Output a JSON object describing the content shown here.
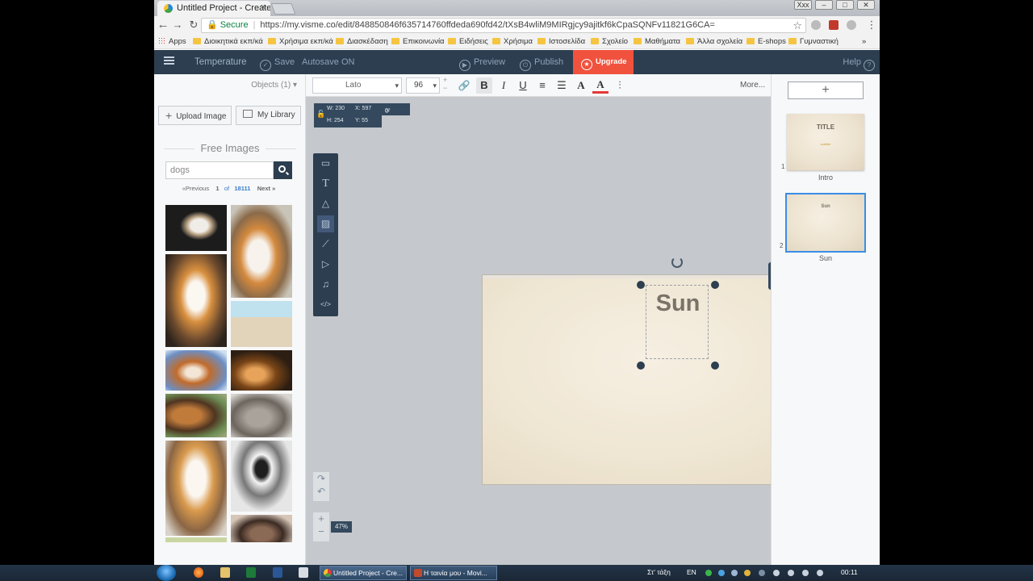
{
  "browser": {
    "tab_title": "Untitled Project - Create",
    "tab_close": "×",
    "window_buttons": [
      "Xxx",
      "–",
      "□",
      "✕"
    ],
    "url_secure_label": "Secure",
    "url": "https://my.visme.co/edit/848850846f635714760ffdeda690fd42/tXsB4wliM9MIRgjcy9ajitkf6kCpaSQNFv11821G6CA=",
    "bookmarks": [
      "Apps",
      "Διοικητικά εκπ/κά",
      "Χρήσιμα εκπ/κά",
      "Διασκέδαση",
      "Επικοινωνία",
      "Ειδήσεις",
      "Χρήσιμα",
      "Ιστοσελίδα",
      "Σχολείο",
      "Μαθήματα",
      "Άλλα σχολεία",
      "E-shops",
      "Γυμναστική"
    ],
    "bookmarks_more": "»"
  },
  "visme": {
    "project_name": "Temperature",
    "save_label": "Save",
    "autosave_label": "Autosave",
    "autosave_state": "ON",
    "preview_label": "Preview",
    "publish_label": "Publish",
    "upgrade_label": "Upgrade",
    "help_label": "Help"
  },
  "left_panel": {
    "objects_label": "Objects (1)",
    "upload_label": "Upload Image",
    "library_label": "My Library",
    "free_images_title": "Free Images",
    "search_value": "dogs",
    "pager": {
      "prev": "«Previous",
      "current": "1",
      "of": "of",
      "total": "18111",
      "next": "Next »"
    }
  },
  "format_bar": {
    "font": "Lato",
    "size": "96",
    "more_label": "More..."
  },
  "canvas": {
    "width_label": "W: 230",
    "x_label": "X: 597",
    "rotation_label": "0°",
    "height_label": "H: 254",
    "y_label": "Y: 55",
    "slide_text": "Sun",
    "zoom_label": "47%"
  },
  "slides_panel": {
    "slides": [
      {
        "number": "1",
        "label": "Intro",
        "title": "TITLE",
        "subtitle": "subtitle"
      },
      {
        "number": "2",
        "label": "Sun",
        "title": "Sun"
      }
    ]
  },
  "taskbar": {
    "tasks": [
      "Untitled Project - Cre...",
      "Η ταινία μου - Movi..."
    ],
    "lang_left": "Στ' τάξη",
    "lang": "EN",
    "clock": "00:11"
  },
  "colors": {
    "accent_dark": "#2c3e50",
    "upgrade": "#f0523d",
    "selection_blue": "#3a8ee6"
  }
}
